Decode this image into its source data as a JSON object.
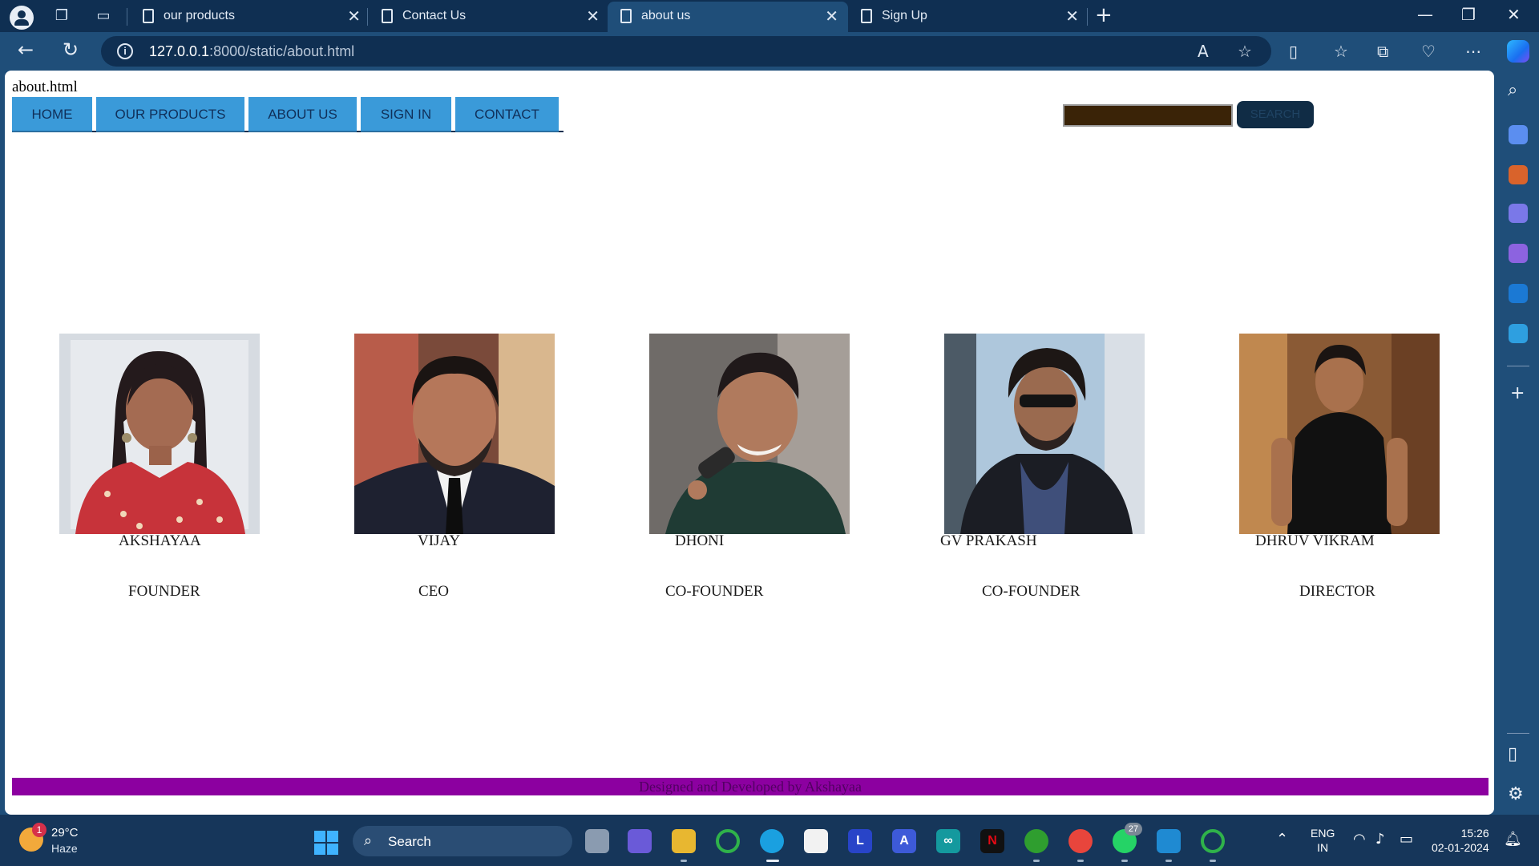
{
  "browser": {
    "tabs": [
      {
        "title": "our products",
        "active": false
      },
      {
        "title": "Contact Us",
        "active": false
      },
      {
        "title": "about us",
        "active": true
      },
      {
        "title": "Sign Up",
        "active": false
      }
    ],
    "address": {
      "host": "127.0.0.1",
      "rest": ":8000/static/about.html"
    }
  },
  "page": {
    "file_label": "about.html",
    "menu": [
      "HOME",
      "OUR PRODUCTS",
      "ABOUT US",
      "SIGN IN",
      "CONTACT"
    ],
    "search": {
      "value": "",
      "button": "SEARCH"
    },
    "team": [
      {
        "name": "AKSHAYAA",
        "role": "FOUNDER",
        "photo": "portrait-akshayaa"
      },
      {
        "name": "VIJAY",
        "role": "CEO",
        "photo": "portrait-vijay"
      },
      {
        "name": "DHONI",
        "role": "CO-FOUNDER",
        "photo": "portrait-dhoni"
      },
      {
        "name": "GV PRAKASH",
        "role": "CO-FOUNDER",
        "photo": "portrait-gv-prakash"
      },
      {
        "name": "DHRUV VIKRAM",
        "role": "DIRECTOR",
        "photo": "portrait-dhruv-vikram"
      }
    ],
    "footer": "Designed and Developed by Akshayaa"
  },
  "taskbar": {
    "weather": {
      "temp": "29°C",
      "condition": "Haze",
      "badge": "1"
    },
    "search_label": "Search",
    "whatsapp_badge": "27",
    "lang": {
      "line1": "ENG",
      "line2": "IN"
    },
    "clock": {
      "time": "15:26",
      "date": "02-01-2024"
    }
  },
  "colors": {
    "nav_button": "#3a9ad9",
    "search_field": "#3a2307",
    "footer_bar": "#8c00a0",
    "browser_chrome": "#1f4e79"
  }
}
